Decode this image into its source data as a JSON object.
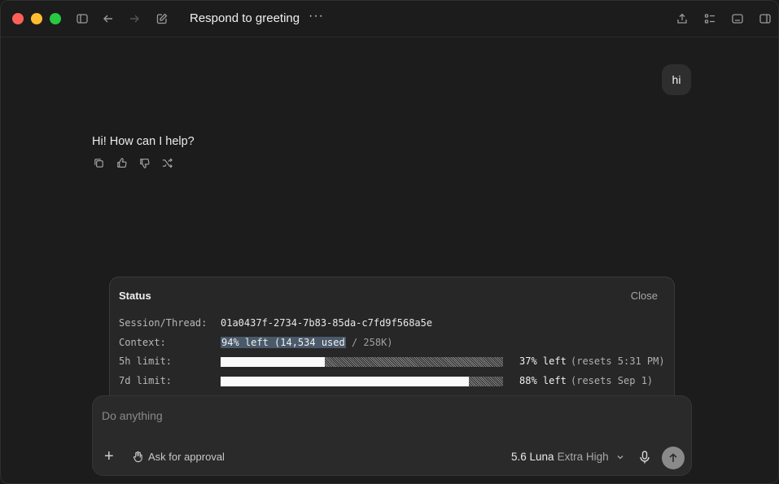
{
  "window": {
    "title": "Respond to greeting",
    "more_label": "···"
  },
  "chat": {
    "user_message": "hi",
    "assistant_message": "Hi! How can I help?"
  },
  "status": {
    "title": "Status",
    "close_label": "Close",
    "rows": {
      "session": {
        "label": "Session/Thread:",
        "value": "01a0437f-2734-7b83-85da-c7fd9f568a5e"
      },
      "context": {
        "label": "Context:",
        "highlight": "94% left (14,534 used",
        "rest": " / 258K)"
      },
      "limit_5h": {
        "label": "5h limit:",
        "percent": "37% left",
        "reset": "(resets 5:31 PM)",
        "fill_fraction": 0.37
      },
      "limit_7d": {
        "label": "7d limit:",
        "percent": "88% left",
        "reset": "(resets Sep 1)",
        "fill_fraction": 0.88
      }
    }
  },
  "composer": {
    "placeholder": "Do anything",
    "approval_label": "Ask for approval",
    "model_name": "5.6 Luna",
    "effort": "Extra High"
  },
  "colors": {
    "traffic_red": "#fe5f57",
    "traffic_yellow": "#febc2e",
    "traffic_green": "#28c840",
    "context_highlight": "#4a5a6a"
  }
}
